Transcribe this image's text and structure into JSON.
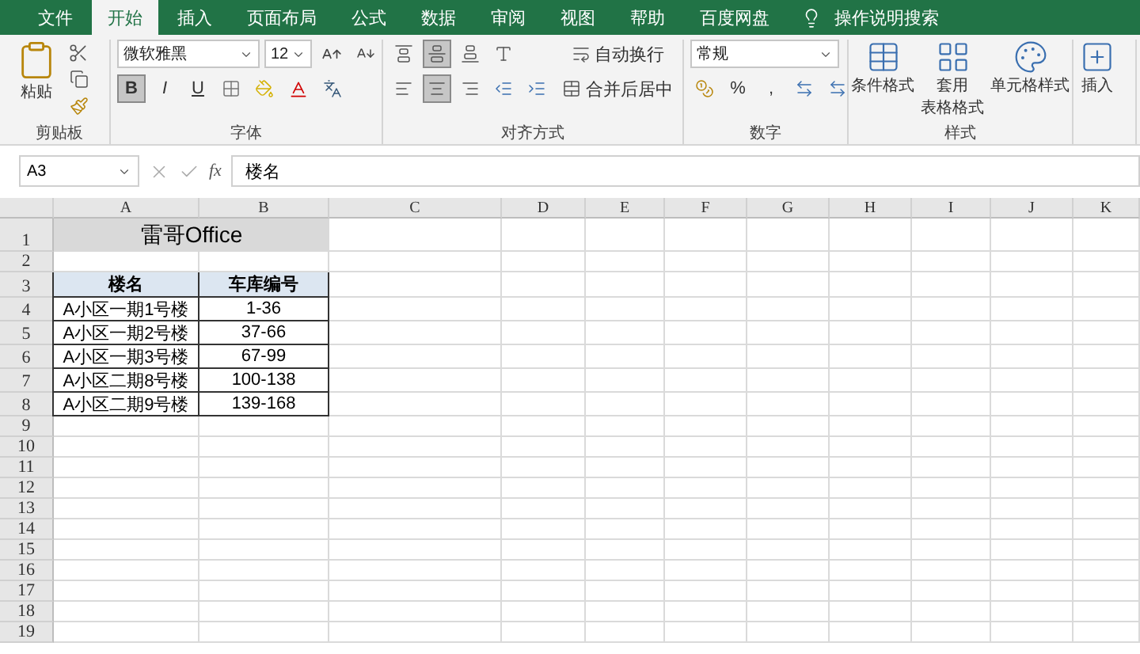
{
  "tabs": [
    {
      "label": "文件",
      "selected": false
    },
    {
      "label": "开始",
      "selected": true
    },
    {
      "label": "插入",
      "selected": false
    },
    {
      "label": "页面布局",
      "selected": false
    },
    {
      "label": "公式",
      "selected": false
    },
    {
      "label": "数据",
      "selected": false
    },
    {
      "label": "审阅",
      "selected": false
    },
    {
      "label": "视图",
      "selected": false
    },
    {
      "label": "帮助",
      "selected": false
    },
    {
      "label": "百度网盘",
      "selected": false
    }
  ],
  "search": {
    "placeholder": "操作说明搜索"
  },
  "ribbon": {
    "clipboard": {
      "label": "剪贴板",
      "paste": "粘贴"
    },
    "font": {
      "label": "字体",
      "font_name": "微软雅黑",
      "font_size": "12",
      "styles": [
        {
          "label": "B",
          "selected": true
        },
        {
          "label": "I",
          "selected": false
        },
        {
          "label": "U",
          "selected": false
        }
      ]
    },
    "alignment": {
      "label": "对齐方式",
      "vertical": [
        {
          "kind": "top",
          "selected": false
        },
        {
          "kind": "middle",
          "selected": true
        },
        {
          "kind": "bottom",
          "selected": false
        }
      ],
      "horizontal": [
        {
          "kind": "left",
          "selected": false
        },
        {
          "kind": "center",
          "selected": true
        },
        {
          "kind": "right",
          "selected": false
        }
      ],
      "wrap": "自动换行",
      "merge": "合并后居中"
    },
    "number": {
      "label": "数字",
      "format": "常规",
      "percent": "%",
      "comma": ","
    },
    "styles": {
      "label": "样式",
      "buttons": [
        {
          "lines": [
            "条件格式"
          ]
        },
        {
          "lines": [
            "套用",
            "表格格式"
          ]
        },
        {
          "lines": [
            "单元格样式"
          ]
        }
      ]
    },
    "cells": {
      "insert": "插入"
    }
  },
  "formula_bar": {
    "name_box": "A3",
    "function_symbol": "fx",
    "formula": "楼名"
  },
  "sheet": {
    "columns": [
      "A",
      "B",
      "C",
      "D",
      "E",
      "F",
      "G",
      "H",
      "I",
      "J",
      "K"
    ],
    "rows": [
      {
        "number": "1",
        "kind": "title",
        "cells": [
          "雷哥Office"
        ]
      },
      {
        "number": "2",
        "kind": "empty"
      },
      {
        "number": "3",
        "kind": "header",
        "cells": [
          "楼名",
          "车库编号"
        ]
      },
      {
        "number": "4",
        "kind": "data",
        "cells": [
          "A小区一期1号楼",
          "1-36"
        ]
      },
      {
        "number": "5",
        "kind": "data",
        "cells": [
          "A小区一期2号楼",
          "37-66"
        ]
      },
      {
        "number": "6",
        "kind": "data",
        "cells": [
          "A小区一期3号楼",
          "67-99"
        ]
      },
      {
        "number": "7",
        "kind": "data",
        "cells": [
          "A小区二期8号楼",
          "100-138"
        ]
      },
      {
        "number": "8",
        "kind": "data",
        "cells": [
          "A小区二期9号楼",
          "139-168"
        ]
      },
      {
        "number": "9",
        "kind": "empty"
      },
      {
        "number": "10",
        "kind": "empty"
      },
      {
        "number": "11",
        "kind": "empty"
      },
      {
        "number": "12",
        "kind": "empty"
      },
      {
        "number": "13",
        "kind": "empty"
      },
      {
        "number": "14",
        "kind": "empty"
      },
      {
        "number": "15",
        "kind": "empty"
      },
      {
        "number": "16",
        "kind": "empty"
      },
      {
        "number": "17",
        "kind": "empty"
      },
      {
        "number": "18",
        "kind": "empty"
      },
      {
        "number": "19",
        "kind": "empty"
      }
    ]
  }
}
